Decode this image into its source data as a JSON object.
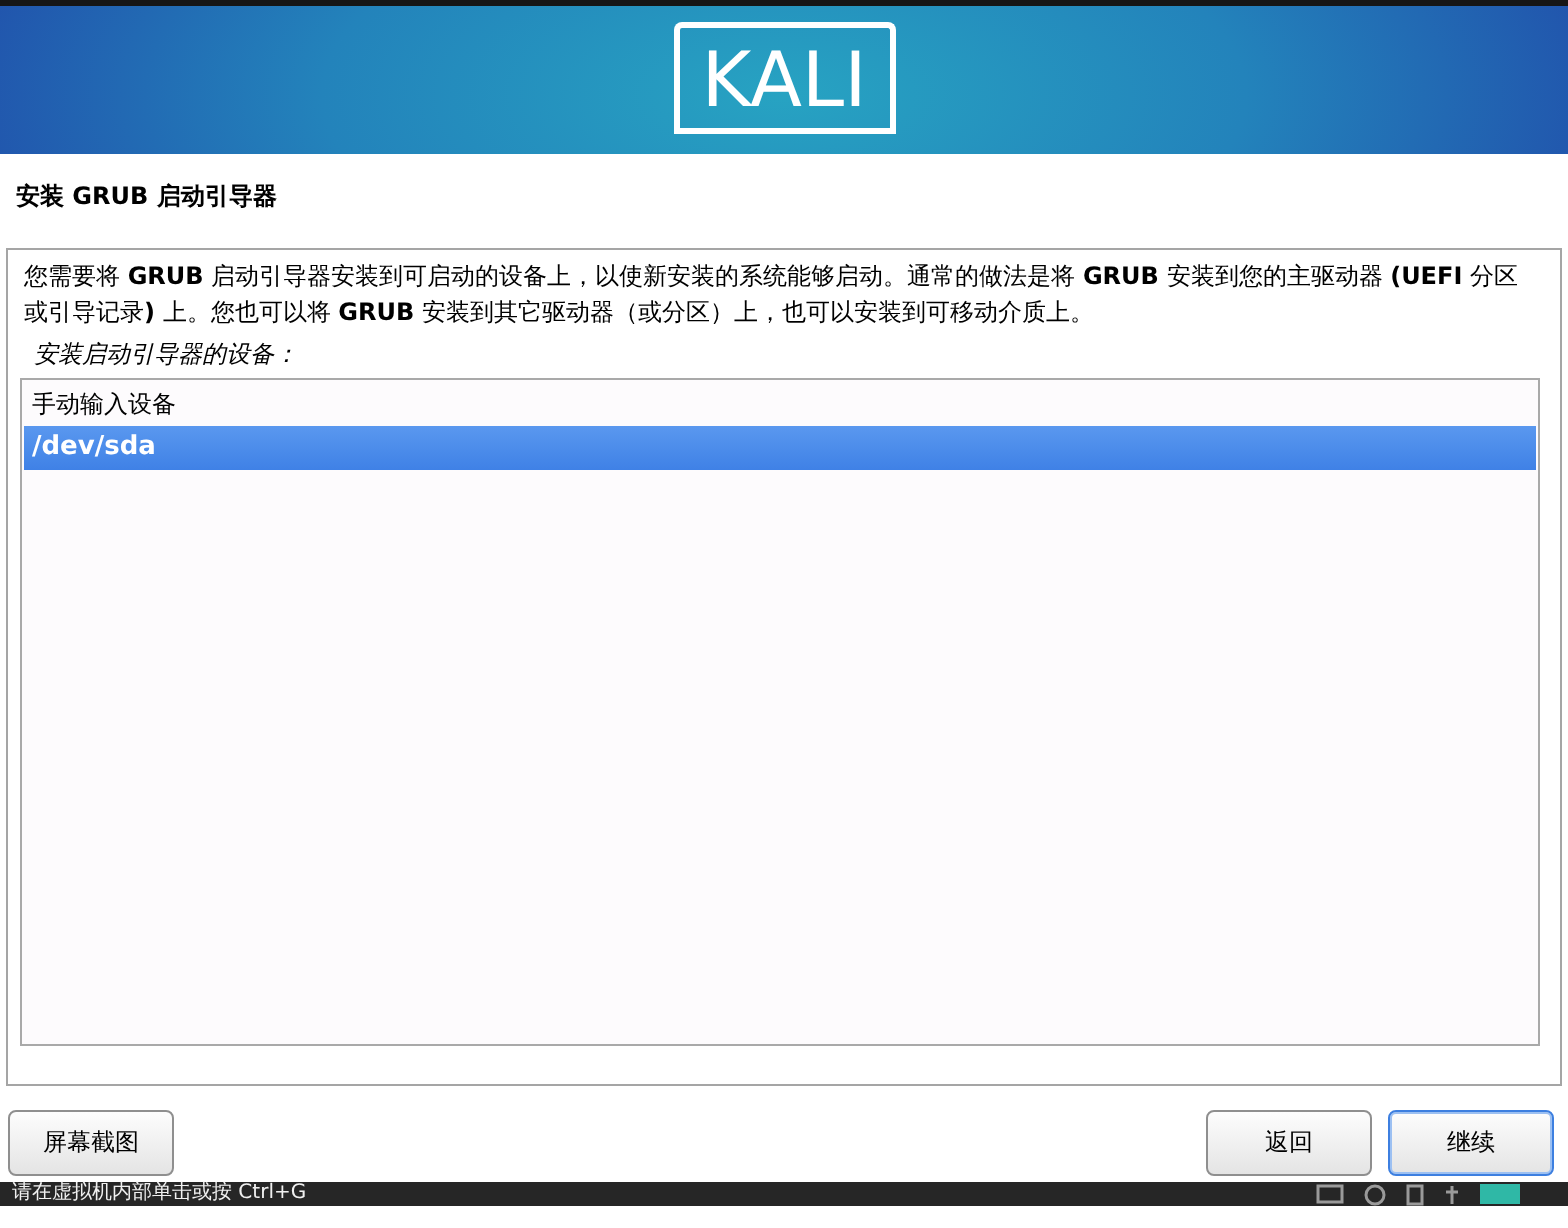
{
  "header": {
    "logo": "KALI"
  },
  "page": {
    "title": "安装 GRUB 启动引导器",
    "description": "您需要将 **GRUB** 启动引导器安装到可启动的设备上，以使新安装的系统能够启动。通常的做法是将 **GRUB** 安装到您的主驱动器 **(UEFI** 分区或引导记录**)** 上。您也可以将 **GRUB** 安装到其它驱动器（或分区）上，也可以安装到可移动介质上。",
    "list_label": "安装启动引导器的设备：",
    "devices": [
      {
        "label": "手动输入设备",
        "selected": false
      },
      {
        "label": "/dev/sda",
        "selected": true
      }
    ]
  },
  "buttons": [
    {
      "label": "屏幕截图",
      "focused": false
    },
    {
      "label": "返回",
      "focused": false
    },
    {
      "label": "继续",
      "focused": true
    }
  ],
  "vm_bar": {
    "hint": "请在虚拟机内部单击或按 Ctrl+G"
  }
}
